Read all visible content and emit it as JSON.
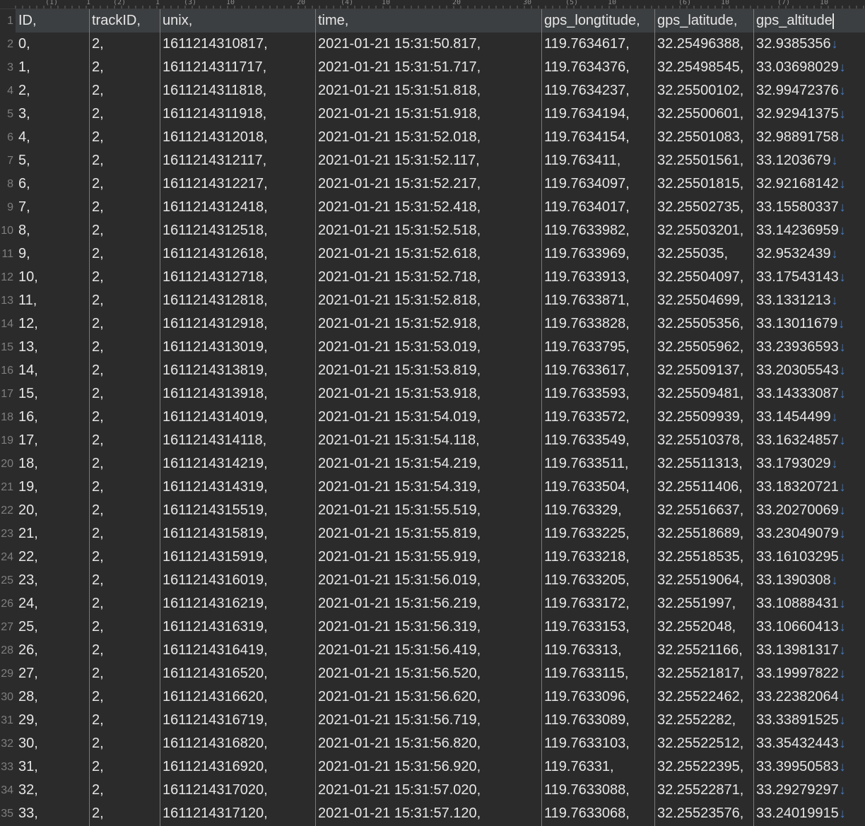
{
  "ruler": {
    "labels": [
      "(1)",
      "1",
      "(2)",
      "1",
      "(3)",
      "10",
      "20",
      "(4)",
      "10",
      "20",
      "30",
      "(5)",
      "10",
      "(6)",
      "10",
      "(7)",
      "10"
    ]
  },
  "colors": {
    "background": "#2b2b2b",
    "text": "#e6e6e6",
    "line_number": "#7f7f7f",
    "separator": "#7a7a7a",
    "eol_arrow": "#3d7fd6",
    "current_line": "#3c3f41"
  },
  "eol_symbol": "↓",
  "header": [
    "ID,",
    "trackID,",
    "unix,",
    "time,",
    "gps_longtitude,",
    "gps_latitude,",
    "gps_altitude"
  ],
  "rows": [
    [
      "0,",
      "2,",
      "1611214310817,",
      "2021-01-21 15:31:50.817,",
      "119.7634617,",
      "32.25496388,",
      "32.9385356"
    ],
    [
      "1,",
      "2,",
      "1611214311717,",
      "2021-01-21 15:31:51.717,",
      "119.7634376,",
      "32.25498545,",
      "33.03698029"
    ],
    [
      "2,",
      "2,",
      "1611214311818,",
      "2021-01-21 15:31:51.818,",
      "119.7634237,",
      "32.25500102,",
      "32.99472376"
    ],
    [
      "3,",
      "2,",
      "1611214311918,",
      "2021-01-21 15:31:51.918,",
      "119.7634194,",
      "32.25500601,",
      "32.92941375"
    ],
    [
      "4,",
      "2,",
      "1611214312018,",
      "2021-01-21 15:31:52.018,",
      "119.7634154,",
      "32.25501083,",
      "32.98891758"
    ],
    [
      "5,",
      "2,",
      "1611214312117,",
      "2021-01-21 15:31:52.117,",
      "119.763411,",
      "32.25501561,",
      "33.1203679"
    ],
    [
      "6,",
      "2,",
      "1611214312217,",
      "2021-01-21 15:31:52.217,",
      "119.7634097,",
      "32.25501815,",
      "32.92168142"
    ],
    [
      "7,",
      "2,",
      "1611214312418,",
      "2021-01-21 15:31:52.418,",
      "119.7634017,",
      "32.25502735,",
      "33.15580337"
    ],
    [
      "8,",
      "2,",
      "1611214312518,",
      "2021-01-21 15:31:52.518,",
      "119.7633982,",
      "32.25503201,",
      "33.14236959"
    ],
    [
      "9,",
      "2,",
      "1611214312618,",
      "2021-01-21 15:31:52.618,",
      "119.7633969,",
      "32.255035,",
      "32.9532439"
    ],
    [
      "10,",
      "2,",
      "1611214312718,",
      "2021-01-21 15:31:52.718,",
      "119.7633913,",
      "32.25504097,",
      "33.17543143"
    ],
    [
      "11,",
      "2,",
      "1611214312818,",
      "2021-01-21 15:31:52.818,",
      "119.7633871,",
      "32.25504699,",
      "33.1331213"
    ],
    [
      "12,",
      "2,",
      "1611214312918,",
      "2021-01-21 15:31:52.918,",
      "119.7633828,",
      "32.25505356,",
      "33.13011679"
    ],
    [
      "13,",
      "2,",
      "1611214313019,",
      "2021-01-21 15:31:53.019,",
      "119.7633795,",
      "32.25505962,",
      "33.23936593"
    ],
    [
      "14,",
      "2,",
      "1611214313819,",
      "2021-01-21 15:31:53.819,",
      "119.7633617,",
      "32.25509137,",
      "33.20305543"
    ],
    [
      "15,",
      "2,",
      "1611214313918,",
      "2021-01-21 15:31:53.918,",
      "119.7633593,",
      "32.25509481,",
      "33.14333087"
    ],
    [
      "16,",
      "2,",
      "1611214314019,",
      "2021-01-21 15:31:54.019,",
      "119.7633572,",
      "32.25509939,",
      "33.1454499"
    ],
    [
      "17,",
      "2,",
      "1611214314118,",
      "2021-01-21 15:31:54.118,",
      "119.7633549,",
      "32.25510378,",
      "33.16324857"
    ],
    [
      "18,",
      "2,",
      "1611214314219,",
      "2021-01-21 15:31:54.219,",
      "119.7633511,",
      "32.25511313,",
      "33.1793029"
    ],
    [
      "19,",
      "2,",
      "1611214314319,",
      "2021-01-21 15:31:54.319,",
      "119.7633504,",
      "32.25511406,",
      "33.18320721"
    ],
    [
      "20,",
      "2,",
      "1611214315519,",
      "2021-01-21 15:31:55.519,",
      "119.763329,",
      "32.25516637,",
      "33.20270069"
    ],
    [
      "21,",
      "2,",
      "1611214315819,",
      "2021-01-21 15:31:55.819,",
      "119.7633225,",
      "32.25518689,",
      "33.23049079"
    ],
    [
      "22,",
      "2,",
      "1611214315919,",
      "2021-01-21 15:31:55.919,",
      "119.7633218,",
      "32.25518535,",
      "33.16103295"
    ],
    [
      "23,",
      "2,",
      "1611214316019,",
      "2021-01-21 15:31:56.019,",
      "119.7633205,",
      "32.25519064,",
      "33.1390308"
    ],
    [
      "24,",
      "2,",
      "1611214316219,",
      "2021-01-21 15:31:56.219,",
      "119.7633172,",
      "32.2551997,",
      "33.10888431"
    ],
    [
      "25,",
      "2,",
      "1611214316319,",
      "2021-01-21 15:31:56.319,",
      "119.7633153,",
      "32.2552048,",
      "33.10660413"
    ],
    [
      "26,",
      "2,",
      "1611214316419,",
      "2021-01-21 15:31:56.419,",
      "119.763313,",
      "32.25521166,",
      "33.13981317"
    ],
    [
      "27,",
      "2,",
      "1611214316520,",
      "2021-01-21 15:31:56.520,",
      "119.7633115,",
      "32.25521817,",
      "33.19997822"
    ],
    [
      "28,",
      "2,",
      "1611214316620,",
      "2021-01-21 15:31:56.620,",
      "119.7633096,",
      "32.25522462,",
      "33.22382064"
    ],
    [
      "29,",
      "2,",
      "1611214316719,",
      "2021-01-21 15:31:56.719,",
      "119.7633089,",
      "32.2552282,",
      "33.33891525"
    ],
    [
      "30,",
      "2,",
      "1611214316820,",
      "2021-01-21 15:31:56.820,",
      "119.7633103,",
      "32.25522512,",
      "33.35432443"
    ],
    [
      "31,",
      "2,",
      "1611214316920,",
      "2021-01-21 15:31:56.920,",
      "119.76331,",
      "32.25522395,",
      "33.39950583"
    ],
    [
      "32,",
      "2,",
      "1611214317020,",
      "2021-01-21 15:31:57.020,",
      "119.7633088,",
      "32.25522871,",
      "33.29279297"
    ],
    [
      "33,",
      "2,",
      "1611214317120,",
      "2021-01-21 15:31:57.120,",
      "119.7633068,",
      "32.25523576,",
      "33.24019915"
    ]
  ]
}
